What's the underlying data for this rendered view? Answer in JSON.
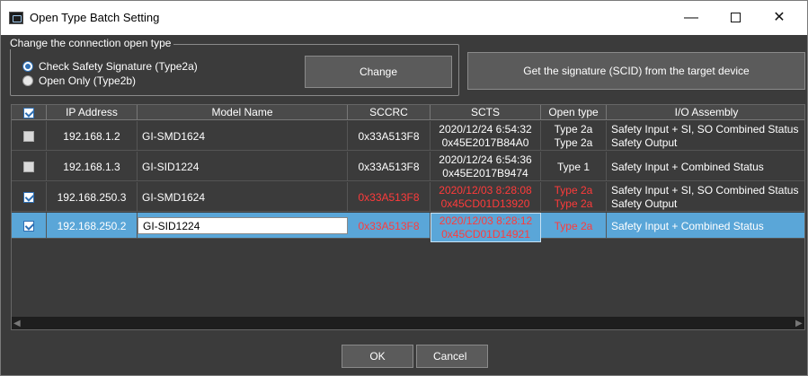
{
  "window": {
    "title": "Open Type Batch Setting",
    "controls": {
      "minimize": "—",
      "close": "✕"
    }
  },
  "group": {
    "legend": "Change the connection open type",
    "options": [
      {
        "label": "Check Safety Signature (Type2a)",
        "checked": true
      },
      {
        "label": "Open Only (Type2b)",
        "checked": false
      }
    ]
  },
  "buttons": {
    "change": "Change",
    "get_signature": "Get the signature (SCID) from the target device",
    "ok": "OK",
    "cancel": "Cancel"
  },
  "grid": {
    "columns": [
      "IP Address",
      "Model Name",
      "SCCRC",
      "SCTS",
      "Open type",
      "I/O Assembly"
    ],
    "rows": [
      {
        "checked": false,
        "ip": "192.168.1.2",
        "model": "GI-SMD1624",
        "sccrc": "0x33A513F8",
        "scts": [
          "2020/12/24 6:54:32",
          "0x45E2017B84A0"
        ],
        "open_type": [
          "Type 2a",
          "Type 2a"
        ],
        "io": [
          "Safety Input + SI, SO Combined Status",
          "Safety Output"
        ]
      },
      {
        "checked": false,
        "ip": "192.168.1.3",
        "model": "GI-SID1224",
        "sccrc": "0x33A513F8",
        "scts": [
          "2020/12/24 6:54:36",
          "0x45E2017B9474"
        ],
        "open_type": [
          "Type 1"
        ],
        "io": [
          "Safety Input + Combined Status"
        ]
      },
      {
        "checked": true,
        "ip": "192.168.250.3",
        "model": "GI-SMD1624",
        "sccrc": "0x33A513F8",
        "scts": [
          "2020/12/03 8:28:08",
          "0x45CD01D13920"
        ],
        "open_type": [
          "Type 2a",
          "Type 2a"
        ],
        "io": [
          "Safety Input + SI, SO Combined Status",
          "Safety Output"
        ]
      },
      {
        "checked": true,
        "ip": "192.168.250.2",
        "model": "GI-SID1224",
        "sccrc": "0x33A513F8",
        "scts": [
          "2020/12/03 8:28:12",
          "0x45CD01D14921"
        ],
        "open_type": [
          "Type 2a"
        ],
        "io": [
          "Safety Input + Combined Status"
        ]
      }
    ]
  },
  "colors": {
    "background": "#3b3b3b",
    "selected_row": "#5aa6d8",
    "mismatch_text": "#ff3b3b",
    "accent": "#2e6fb4"
  }
}
